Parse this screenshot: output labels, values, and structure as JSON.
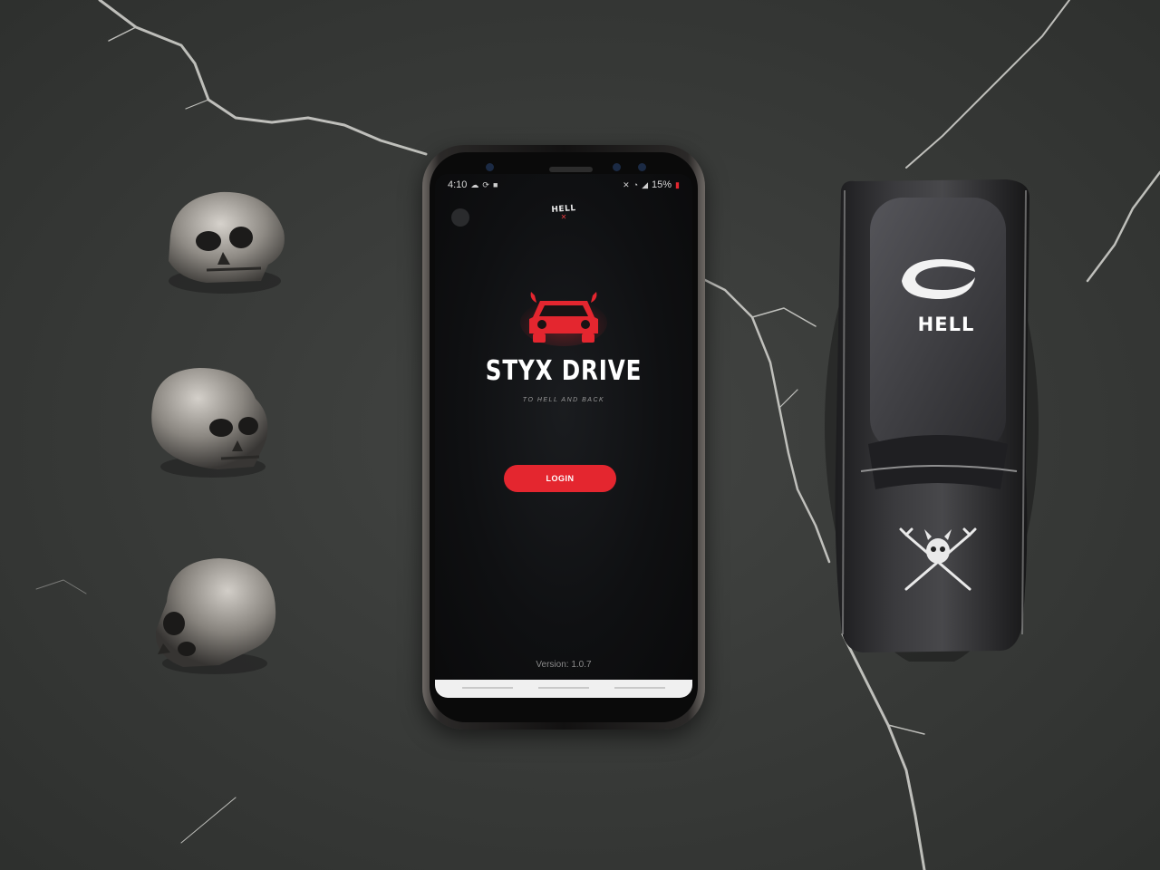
{
  "status_bar": {
    "time": "4:10",
    "battery": "15%",
    "icons": [
      "cloud-icon",
      "sync-icon",
      "shop-icon",
      "mute-icon",
      "wifi-icon",
      "signal-icon",
      "battery-icon"
    ]
  },
  "app": {
    "logo_text": "HELL",
    "title": "STYX DRIVE",
    "tagline": "TO HELL AND BACK",
    "login_label": "LOGIN",
    "version": "Version: 1.0.7"
  },
  "props": {
    "car_badge_text": "HELL"
  },
  "colors": {
    "accent": "#e4262f",
    "screen_bg": "#0f1012",
    "table": "#3b3d3b"
  }
}
